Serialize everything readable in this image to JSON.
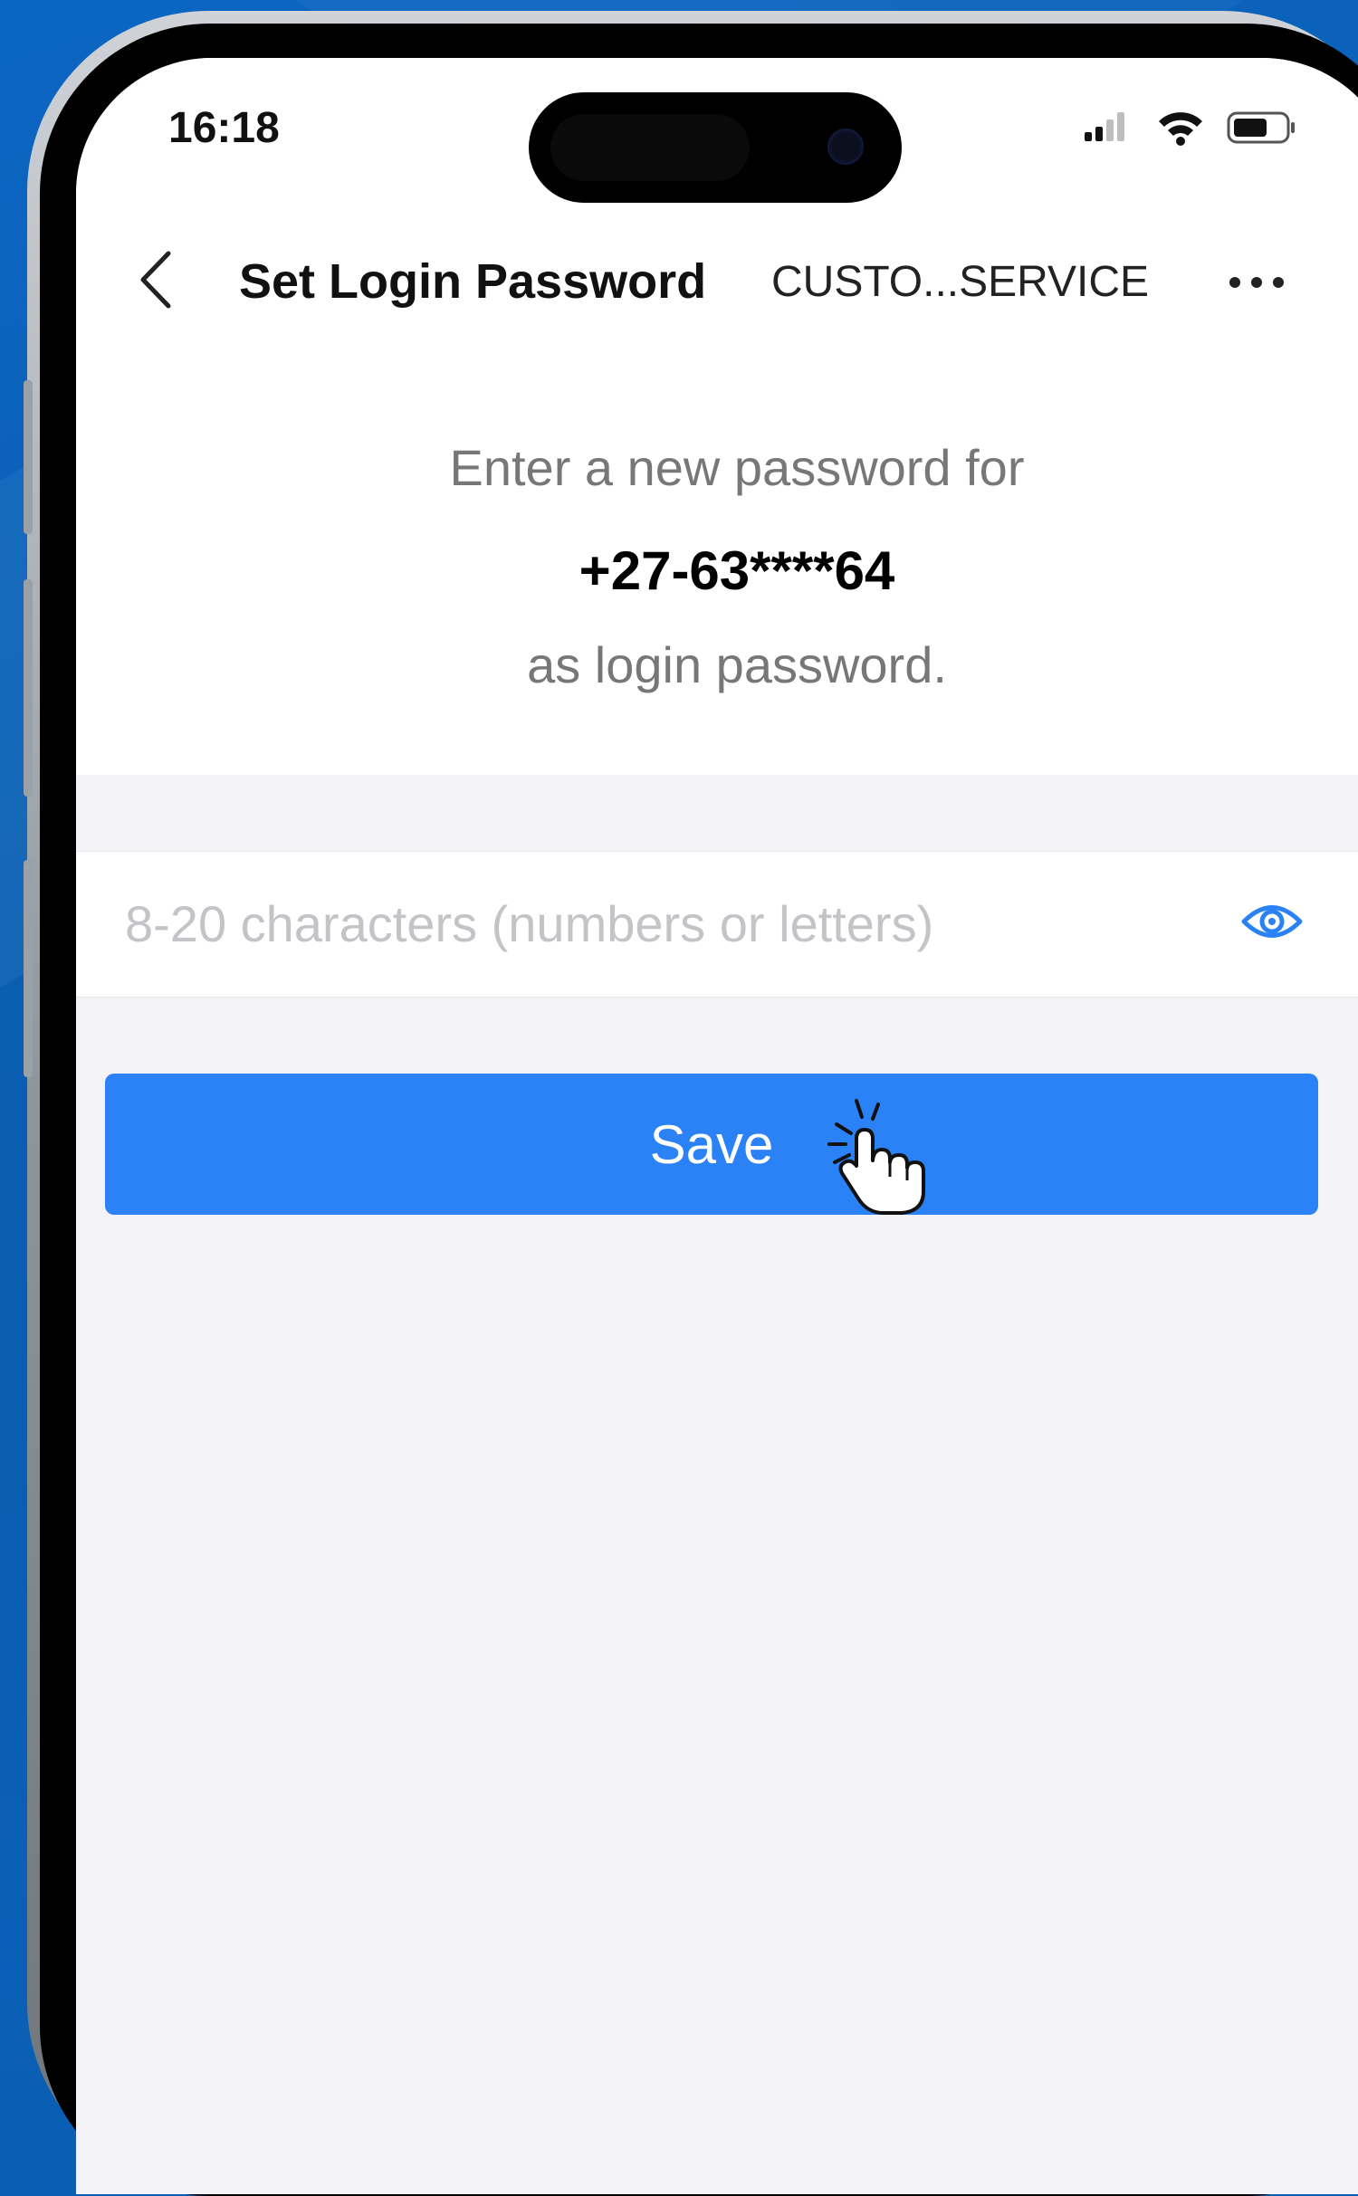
{
  "status_bar": {
    "time": "16:18"
  },
  "nav": {
    "title": "Set Login Password",
    "subtitle": "CUSTO...SERVICE",
    "back_icon": "chevron-left-icon",
    "more_icon": "ellipsis-icon"
  },
  "prompt": {
    "line1": "Enter a new password for",
    "phone": "+27-63****64",
    "line2": "as login password."
  },
  "password_field": {
    "placeholder": "8-20 characters (numbers or letters)",
    "value": "",
    "toggle_icon": "eye-icon"
  },
  "save_button": {
    "label": "Save",
    "cursor_icon": "pointing-hand-icon"
  },
  "colors": {
    "background": "#0a5fb4",
    "accent": "#2a82f6",
    "screen_bg": "#f2f2f7",
    "placeholder": "#c4c4c8"
  }
}
